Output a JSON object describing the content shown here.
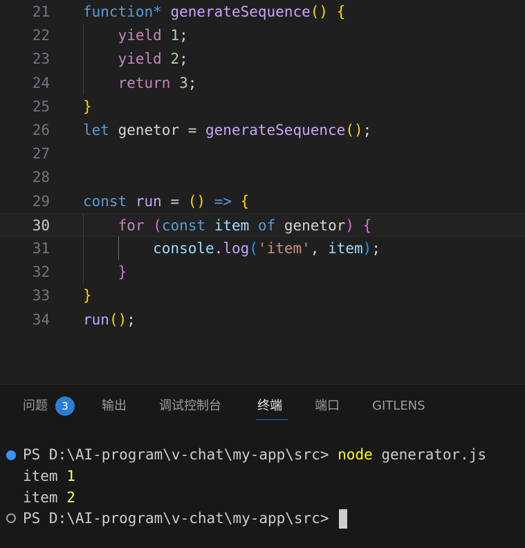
{
  "editor": {
    "lines": [
      {
        "n": "21",
        "tokens": [
          [
            "function*",
            "kw2"
          ],
          [
            " ",
            "pun"
          ],
          [
            "generateSequence",
            "fnp"
          ],
          [
            "()",
            "b1"
          ],
          [
            " ",
            "pun"
          ],
          [
            "{",
            "b1"
          ]
        ]
      },
      {
        "n": "22",
        "tokens": [
          [
            "    ",
            "pun"
          ],
          [
            "yield",
            "kw"
          ],
          [
            " ",
            "pun"
          ],
          [
            "1",
            "num"
          ],
          [
            ";",
            "pun"
          ]
        ]
      },
      {
        "n": "23",
        "tokens": [
          [
            "    ",
            "pun"
          ],
          [
            "yield",
            "kw"
          ],
          [
            " ",
            "pun"
          ],
          [
            "2",
            "num"
          ],
          [
            ";",
            "pun"
          ]
        ]
      },
      {
        "n": "24",
        "tokens": [
          [
            "    ",
            "pun"
          ],
          [
            "return",
            "kw"
          ],
          [
            " ",
            "pun"
          ],
          [
            "3",
            "num"
          ],
          [
            ";",
            "pun"
          ]
        ]
      },
      {
        "n": "25",
        "tokens": [
          [
            "}",
            "b1"
          ]
        ]
      },
      {
        "n": "26",
        "tokens": [
          [
            "let",
            "kw2"
          ],
          [
            " genetor = ",
            "pun"
          ],
          [
            "generateSequence",
            "fnp"
          ],
          [
            "()",
            "b1"
          ],
          [
            ";",
            "pun"
          ]
        ]
      },
      {
        "n": "27",
        "tokens": []
      },
      {
        "n": "28",
        "tokens": []
      },
      {
        "n": "29",
        "tokens": [
          [
            "const",
            "kw2"
          ],
          [
            " ",
            "pun"
          ],
          [
            "run",
            "fnp"
          ],
          [
            " = ",
            "pun"
          ],
          [
            "()",
            "b1"
          ],
          [
            " ",
            "pun"
          ],
          [
            "=>",
            "kw2"
          ],
          [
            " ",
            "pun"
          ],
          [
            "{",
            "b1"
          ]
        ]
      },
      {
        "n": "30",
        "tokens": [
          [
            "    ",
            "pun"
          ],
          [
            "for",
            "kw"
          ],
          [
            " ",
            "pun"
          ],
          [
            "(",
            "b2"
          ],
          [
            "const",
            "kw2"
          ],
          [
            " ",
            "pun"
          ],
          [
            "item",
            "var"
          ],
          [
            " ",
            "pun"
          ],
          [
            "of",
            "kw2"
          ],
          [
            " genetor",
            "pun"
          ],
          [
            ")",
            "b2"
          ],
          [
            " ",
            "pun"
          ],
          [
            "{",
            "b2"
          ]
        ]
      },
      {
        "n": "31",
        "tokens": [
          [
            "        ",
            "pun"
          ],
          [
            "console",
            "var"
          ],
          [
            ".",
            "pun"
          ],
          [
            "log",
            "fnp"
          ],
          [
            "(",
            "b3"
          ],
          [
            "'item'",
            "str"
          ],
          [
            ", ",
            "pun"
          ],
          [
            "item",
            "var"
          ],
          [
            ")",
            "b3"
          ],
          [
            ";",
            "pun"
          ]
        ]
      },
      {
        "n": "32",
        "tokens": [
          [
            "    ",
            "pun"
          ],
          [
            "}",
            "b2"
          ]
        ]
      },
      {
        "n": "33",
        "tokens": [
          [
            "}",
            "b1"
          ]
        ]
      },
      {
        "n": "34",
        "tokens": [
          [
            "run",
            "fnp"
          ],
          [
            "()",
            "b1"
          ],
          [
            ";",
            "pun"
          ]
        ]
      }
    ],
    "active_line": "30"
  },
  "panel": {
    "tabs": [
      {
        "label": "问题",
        "active": false
      },
      {
        "label": "输出",
        "active": false
      },
      {
        "label": "调试控制台",
        "active": false
      },
      {
        "label": "终端",
        "active": true
      },
      {
        "label": "端口",
        "active": false
      },
      {
        "label": "GITLENS",
        "active": false
      }
    ],
    "problems_count": "3"
  },
  "terminal": {
    "prompt1": "PS D:\\AI-program\\v-chat\\my-app\\src> ",
    "command_name": "node",
    "command_arg": " generator.js",
    "out1_label": "item ",
    "out1_value": "1",
    "out2_label": "item ",
    "out2_value": "2",
    "prompt2": "PS D:\\AI-program\\v-chat\\my-app\\src> "
  }
}
